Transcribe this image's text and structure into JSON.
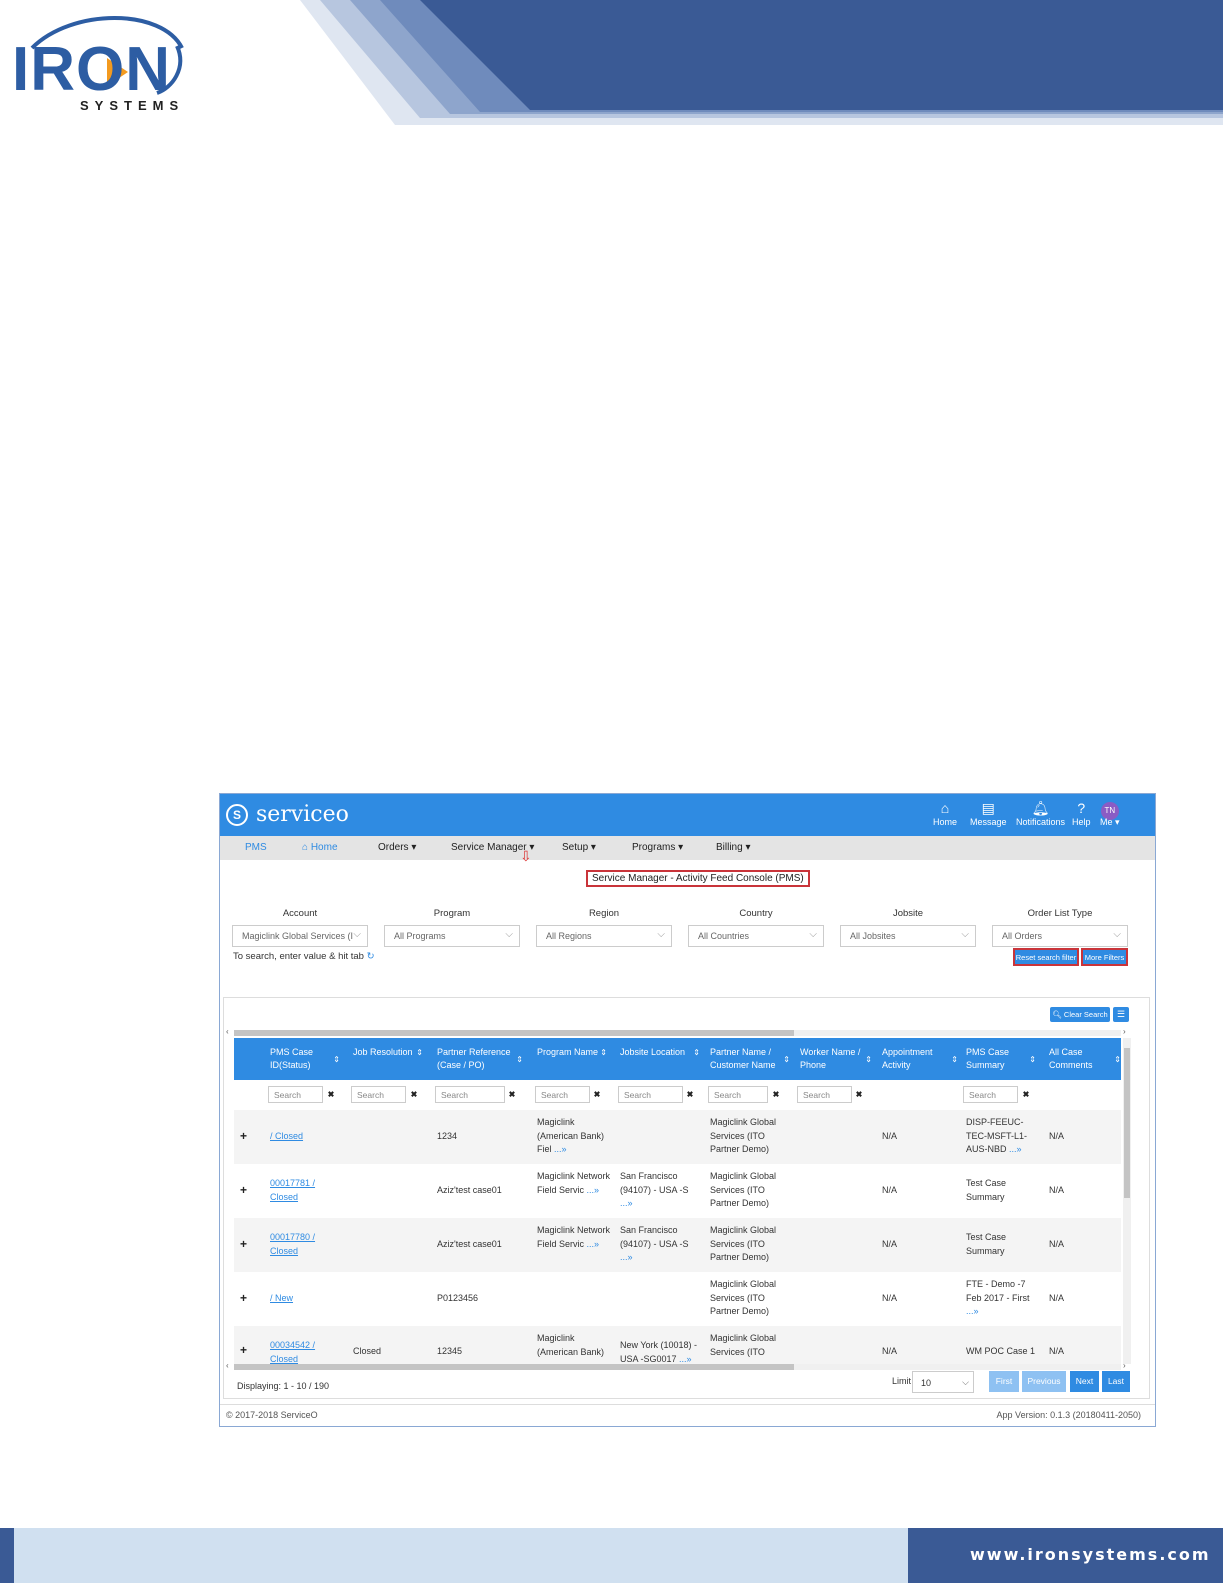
{
  "doc": {
    "logo_word": "IRON",
    "logo_sub": "SYSTEMS",
    "footer_url": "www.ironsystems.com",
    "brand_color": "#2d5da3"
  },
  "app": {
    "name": "serviceo",
    "top_nav": [
      {
        "icon": "home-icon",
        "label": "Home"
      },
      {
        "icon": "message-icon",
        "label": "Message"
      },
      {
        "icon": "bell-icon",
        "label": "Notifications"
      },
      {
        "icon": "help-icon",
        "label": "Help"
      }
    ],
    "avatar_initials": "TN",
    "me_label": "Me",
    "menu": {
      "pms": "PMS",
      "home": "Home",
      "orders": "Orders",
      "service_manager": "Service Manager",
      "setup": "Setup",
      "programs": "Programs",
      "billing": "Billing"
    },
    "console_title": "Service Manager - Activity Feed Console (PMS)",
    "filters": [
      {
        "label": "Account",
        "value": "Magiclink Global Services (I"
      },
      {
        "label": "Program",
        "value": "All Programs"
      },
      {
        "label": "Region",
        "value": "All Regions"
      },
      {
        "label": "Country",
        "value": "All Countries"
      },
      {
        "label": "Jobsite",
        "value": "All Jobsites"
      },
      {
        "label": "Order List Type",
        "value": "All Orders"
      }
    ],
    "search_hint": "To search, enter value & hit tab",
    "reset_button": "Reset search filter",
    "more_filters_button": "More Filters",
    "clear_search_button": "Clear Search",
    "columns": [
      "PMS Case ID(Status)",
      "Job Resolution",
      "Partner Reference (Case / PO)",
      "Program Name",
      "Jobsite Location",
      "Partner Name / Customer Name",
      "Worker Name / Phone",
      "Appointment Activity",
      "PMS Case Summary",
      "All Case Comments"
    ],
    "search_placeholder": "Search",
    "more_marker": "...»",
    "rows": [
      {
        "case": "/ Closed",
        "resolution": "",
        "partner_ref": "1234",
        "program": "Magiclink (American Bank) Fiel",
        "jobsite": "",
        "partner": "Magiclink Global Services (ITO Partner Demo)",
        "worker": "",
        "appointment": "N/A",
        "summary": "DISP-FEEUC-TEC-MSFT-L1-AUS-NBD",
        "comments": "N/A"
      },
      {
        "case": "00017781 / Closed",
        "resolution": "",
        "partner_ref": "Aziz'test case01",
        "program": "Magiclink Network Field Servic",
        "jobsite": "San Francisco (94107) - USA -S",
        "partner": "Magiclink Global Services (ITO Partner Demo)",
        "worker": "",
        "appointment": "N/A",
        "summary": "Test Case Summary",
        "comments": "N/A"
      },
      {
        "case": "00017780 / Closed",
        "resolution": "",
        "partner_ref": "Aziz'test case01",
        "program": "Magiclink Network Field Servic",
        "jobsite": "San Francisco (94107) - USA -S",
        "partner": "Magiclink Global Services (ITO Partner Demo)",
        "worker": "",
        "appointment": "N/A",
        "summary": "Test Case Summary",
        "comments": "N/A"
      },
      {
        "case": "/ New",
        "resolution": "",
        "partner_ref": "P0123456",
        "program": "",
        "jobsite": "",
        "partner": "Magiclink Global Services (ITO Partner Demo)",
        "worker": "",
        "appointment": "N/A",
        "summary": "FTE - Demo -7 Feb 2017 - First",
        "comments": "N/A"
      },
      {
        "case": "00034542 / Closed",
        "resolution": "Closed",
        "partner_ref": "12345",
        "program": "Magiclink (American Bank)",
        "jobsite": "New York (10018) - USA -SG0017",
        "partner": "Magiclink Global Services (ITO",
        "worker": "",
        "appointment": "N/A",
        "summary": "WM POC Case 1",
        "comments": "N/A"
      }
    ],
    "display_count": "Displaying: 1 - 10 / 190",
    "limit_label": "Limit",
    "limit_value": "10",
    "pagination": {
      "first": "First",
      "previous": "Previous",
      "next": "Next",
      "last": "Last"
    },
    "copyright": "© 2017-2018 ServiceO",
    "app_version": "App Version: 0.1.3 (20180411-2050)",
    "accent_color": "#2f8be2",
    "highlight_color": "#c9343a"
  }
}
